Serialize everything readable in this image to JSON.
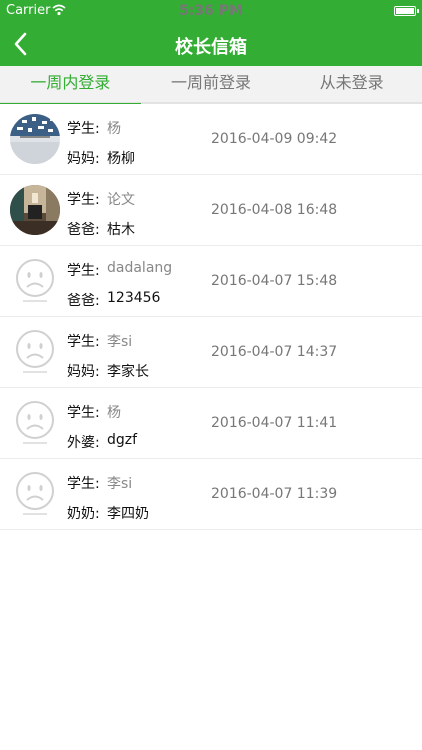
{
  "status_bar": {
    "carrier": "Carrier",
    "time": "5:36 PM"
  },
  "nav": {
    "title": "校长信箱"
  },
  "tabs": [
    {
      "label": "一周内登录",
      "active": true
    },
    {
      "label": "一周前登录",
      "active": false
    },
    {
      "label": "从未登录",
      "active": false
    }
  ],
  "rows": [
    {
      "avatar": "photo-blue",
      "label1": "学生:",
      "value1": "杨",
      "label2": "妈妈:",
      "value2": "杨柳",
      "time": "2016-04-09 09:42"
    },
    {
      "avatar": "photo-room",
      "label1": "学生:",
      "value1": "论文",
      "label2": "爸爸:",
      "value2": "枯木",
      "time": "2016-04-08 16:48"
    },
    {
      "avatar": "default-sad-face",
      "label1": "学生:",
      "value1": "dadalang",
      "label2": "爸爸:",
      "value2": "123456",
      "time": "2016-04-07 15:48"
    },
    {
      "avatar": "default-sad-face",
      "label1": "学生:",
      "value1": "李si",
      "label2": "妈妈:",
      "value2": "李家长",
      "time": "2016-04-07 14:37"
    },
    {
      "avatar": "default-sad-face",
      "label1": "学生:",
      "value1": "杨",
      "label2": "外婆:",
      "value2": "dgzf",
      "time": "2016-04-07 11:41"
    },
    {
      "avatar": "default-sad-face",
      "label1": "学生:",
      "value1": "李si",
      "label2": "奶奶:",
      "value2": "李四奶",
      "time": "2016-04-07 11:39"
    }
  ],
  "colors": {
    "brand": "#33ad33",
    "tab_bg": "#f2f2f2"
  }
}
